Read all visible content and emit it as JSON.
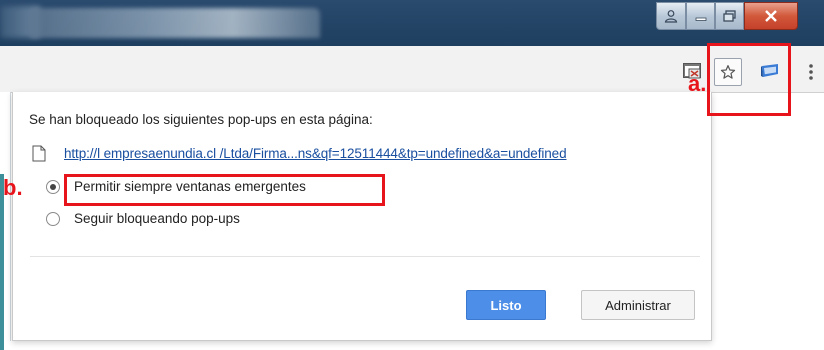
{
  "titlebar": {
    "window_buttons": {
      "person_icon": "person-icon",
      "minimize_icon": "minimize-icon",
      "maximize_icon": "maximize-icon",
      "close_icon": "close-icon"
    }
  },
  "toolbar": {
    "icons": [
      "popup-blocked-icon",
      "star-icon",
      "extension-icon",
      "menu-icon"
    ]
  },
  "bubble": {
    "heading": "Se han bloqueado los siguientes pop-ups en esta página:",
    "link": "http://l empresaenundia.cl /Ltda/Firma...ns&qf=12511444&tp=undefined&a=undefined",
    "options": [
      {
        "label": "Permitir siempre ventanas emergentes",
        "selected": true
      },
      {
        "label": "Seguir bloqueando pop-ups",
        "selected": false
      }
    ],
    "buttons": {
      "done": "Listo",
      "manage": "Administrar"
    }
  },
  "annotations": {
    "a": "a.",
    "b": "b."
  },
  "colors": {
    "annotation_red": "#e8141c",
    "primary_button": "#4d8ee8",
    "link": "#1a4fa0"
  }
}
